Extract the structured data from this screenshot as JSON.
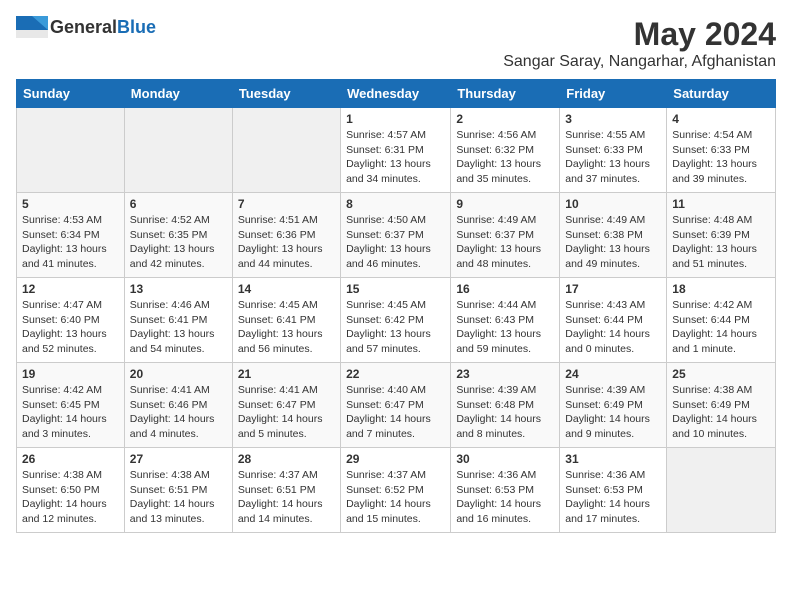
{
  "header": {
    "logo_general": "General",
    "logo_blue": "Blue",
    "month": "May 2024",
    "location": "Sangar Saray, Nangarhar, Afghanistan"
  },
  "weekdays": [
    "Sunday",
    "Monday",
    "Tuesday",
    "Wednesday",
    "Thursday",
    "Friday",
    "Saturday"
  ],
  "weeks": [
    [
      {
        "day": "",
        "content": ""
      },
      {
        "day": "",
        "content": ""
      },
      {
        "day": "",
        "content": ""
      },
      {
        "day": "1",
        "content": "Sunrise: 4:57 AM\nSunset: 6:31 PM\nDaylight: 13 hours\nand 34 minutes."
      },
      {
        "day": "2",
        "content": "Sunrise: 4:56 AM\nSunset: 6:32 PM\nDaylight: 13 hours\nand 35 minutes."
      },
      {
        "day": "3",
        "content": "Sunrise: 4:55 AM\nSunset: 6:33 PM\nDaylight: 13 hours\nand 37 minutes."
      },
      {
        "day": "4",
        "content": "Sunrise: 4:54 AM\nSunset: 6:33 PM\nDaylight: 13 hours\nand 39 minutes."
      }
    ],
    [
      {
        "day": "5",
        "content": "Sunrise: 4:53 AM\nSunset: 6:34 PM\nDaylight: 13 hours\nand 41 minutes."
      },
      {
        "day": "6",
        "content": "Sunrise: 4:52 AM\nSunset: 6:35 PM\nDaylight: 13 hours\nand 42 minutes."
      },
      {
        "day": "7",
        "content": "Sunrise: 4:51 AM\nSunset: 6:36 PM\nDaylight: 13 hours\nand 44 minutes."
      },
      {
        "day": "8",
        "content": "Sunrise: 4:50 AM\nSunset: 6:37 PM\nDaylight: 13 hours\nand 46 minutes."
      },
      {
        "day": "9",
        "content": "Sunrise: 4:49 AM\nSunset: 6:37 PM\nDaylight: 13 hours\nand 48 minutes."
      },
      {
        "day": "10",
        "content": "Sunrise: 4:49 AM\nSunset: 6:38 PM\nDaylight: 13 hours\nand 49 minutes."
      },
      {
        "day": "11",
        "content": "Sunrise: 4:48 AM\nSunset: 6:39 PM\nDaylight: 13 hours\nand 51 minutes."
      }
    ],
    [
      {
        "day": "12",
        "content": "Sunrise: 4:47 AM\nSunset: 6:40 PM\nDaylight: 13 hours\nand 52 minutes."
      },
      {
        "day": "13",
        "content": "Sunrise: 4:46 AM\nSunset: 6:41 PM\nDaylight: 13 hours\nand 54 minutes."
      },
      {
        "day": "14",
        "content": "Sunrise: 4:45 AM\nSunset: 6:41 PM\nDaylight: 13 hours\nand 56 minutes."
      },
      {
        "day": "15",
        "content": "Sunrise: 4:45 AM\nSunset: 6:42 PM\nDaylight: 13 hours\nand 57 minutes."
      },
      {
        "day": "16",
        "content": "Sunrise: 4:44 AM\nSunset: 6:43 PM\nDaylight: 13 hours\nand 59 minutes."
      },
      {
        "day": "17",
        "content": "Sunrise: 4:43 AM\nSunset: 6:44 PM\nDaylight: 14 hours\nand 0 minutes."
      },
      {
        "day": "18",
        "content": "Sunrise: 4:42 AM\nSunset: 6:44 PM\nDaylight: 14 hours\nand 1 minute."
      }
    ],
    [
      {
        "day": "19",
        "content": "Sunrise: 4:42 AM\nSunset: 6:45 PM\nDaylight: 14 hours\nand 3 minutes."
      },
      {
        "day": "20",
        "content": "Sunrise: 4:41 AM\nSunset: 6:46 PM\nDaylight: 14 hours\nand 4 minutes."
      },
      {
        "day": "21",
        "content": "Sunrise: 4:41 AM\nSunset: 6:47 PM\nDaylight: 14 hours\nand 5 minutes."
      },
      {
        "day": "22",
        "content": "Sunrise: 4:40 AM\nSunset: 6:47 PM\nDaylight: 14 hours\nand 7 minutes."
      },
      {
        "day": "23",
        "content": "Sunrise: 4:39 AM\nSunset: 6:48 PM\nDaylight: 14 hours\nand 8 minutes."
      },
      {
        "day": "24",
        "content": "Sunrise: 4:39 AM\nSunset: 6:49 PM\nDaylight: 14 hours\nand 9 minutes."
      },
      {
        "day": "25",
        "content": "Sunrise: 4:38 AM\nSunset: 6:49 PM\nDaylight: 14 hours\nand 10 minutes."
      }
    ],
    [
      {
        "day": "26",
        "content": "Sunrise: 4:38 AM\nSunset: 6:50 PM\nDaylight: 14 hours\nand 12 minutes."
      },
      {
        "day": "27",
        "content": "Sunrise: 4:38 AM\nSunset: 6:51 PM\nDaylight: 14 hours\nand 13 minutes."
      },
      {
        "day": "28",
        "content": "Sunrise: 4:37 AM\nSunset: 6:51 PM\nDaylight: 14 hours\nand 14 minutes."
      },
      {
        "day": "29",
        "content": "Sunrise: 4:37 AM\nSunset: 6:52 PM\nDaylight: 14 hours\nand 15 minutes."
      },
      {
        "day": "30",
        "content": "Sunrise: 4:36 AM\nSunset: 6:53 PM\nDaylight: 14 hours\nand 16 minutes."
      },
      {
        "day": "31",
        "content": "Sunrise: 4:36 AM\nSunset: 6:53 PM\nDaylight: 14 hours\nand 17 minutes."
      },
      {
        "day": "",
        "content": ""
      }
    ]
  ]
}
